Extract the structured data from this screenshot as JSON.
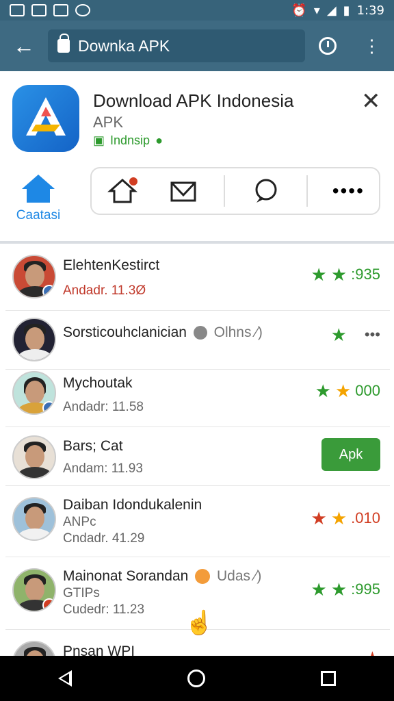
{
  "status": {
    "time": "1:39"
  },
  "browser": {
    "url": "Downka APK"
  },
  "app": {
    "title": "Download APK Indonesia",
    "subtitle": "APK",
    "tag": "Indnsip",
    "home_label": "Caatasi"
  },
  "items": [
    {
      "name": "ElehtenKestirct",
      "meta": "Andadr. 11.3Ø",
      "rating": ":935",
      "colors": "green"
    },
    {
      "name": "Sorsticouhclanician",
      "extra": "Olhns ⁄)",
      "meta": "",
      "rating": "•••",
      "colors": "green"
    },
    {
      "name": "Mychoutak",
      "meta": "Andadr: 11.58",
      "rating": "000",
      "colors": "green"
    },
    {
      "name": "Bars; Cat",
      "meta": "Andam: 11.93",
      "button": "Apk"
    },
    {
      "name": "Daiban Idondukalenin",
      "meta2": "ANPc",
      "meta": "Cndadr. 41.29",
      "rating": ".010",
      "colors": "red"
    },
    {
      "name": "Mainonat Sorandan",
      "extra": "Udas ⁄)",
      "meta2": "GTIPs",
      "meta": "Cudedr: 11.23",
      "rating": ":995",
      "colors": "green"
    },
    {
      "name": "Pnsan WPI",
      "meta": "",
      "rating": "",
      "colors": "green"
    }
  ]
}
